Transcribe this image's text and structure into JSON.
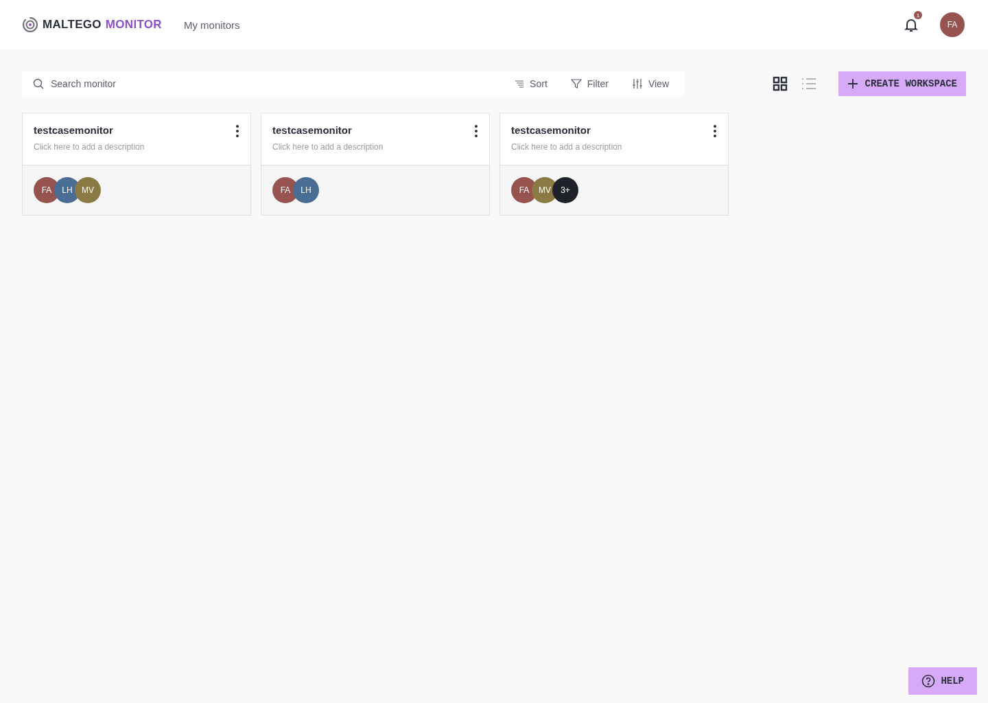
{
  "header": {
    "logo": {
      "brand": "MALTEGO",
      "product": "MONITOR"
    },
    "nav": [
      {
        "label": "My monitors"
      }
    ],
    "notifications": {
      "count": "1"
    },
    "user": {
      "initials": "FA",
      "color": "#97544f"
    }
  },
  "toolbar": {
    "search": {
      "placeholder": "Search monitor"
    },
    "actions": [
      {
        "kind": "sort",
        "label": "Sort"
      },
      {
        "kind": "filter",
        "label": "Filter"
      },
      {
        "kind": "view",
        "label": "View"
      }
    ],
    "view_toggle": [
      {
        "kind": "grid",
        "selected": true
      },
      {
        "kind": "list",
        "selected": false
      }
    ],
    "create_button": "CREATE WORKSPACE"
  },
  "monitors": [
    {
      "title": "testcasemonitor",
      "description": "Click here to add a description",
      "members": [
        {
          "initials": "FA",
          "color": "#97544f"
        },
        {
          "initials": "LH",
          "color": "#4a6d94"
        },
        {
          "initials": "MV",
          "color": "#8c7a45"
        }
      ]
    },
    {
      "title": "testcasemonitor",
      "description": "Click here to add a description",
      "members": [
        {
          "initials": "FA",
          "color": "#97544f"
        },
        {
          "initials": "LH",
          "color": "#4a6d94"
        }
      ]
    },
    {
      "title": "testcasemonitor",
      "description": "Click here to add a description",
      "members": [
        {
          "initials": "FA",
          "color": "#97544f"
        },
        {
          "initials": "MV",
          "color": "#8c7a45"
        },
        {
          "initials": "3+",
          "color": "#1f2329"
        }
      ]
    }
  ],
  "help_button": "HELP"
}
